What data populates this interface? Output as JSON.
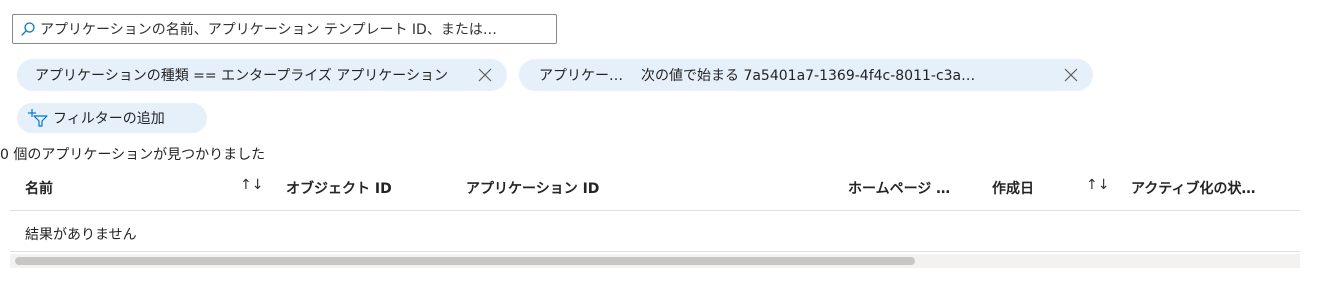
{
  "search": {
    "placeholder": "アプリケーションの名前、アプリケーション テンプレート ID、または…"
  },
  "filters": [
    {
      "label": "アプリケーションの種類 == エンタープライズ アプリケーション"
    },
    {
      "field": "アプリケー…",
      "label": "次の値で始まる 7a5401a7-1369-4f4c-8011-c3a…"
    }
  ],
  "add_filter": {
    "label": "フィルターの追加"
  },
  "result_count": "0 個のアプリケーションが見つかりました",
  "table": {
    "columns": [
      {
        "label": "名前",
        "sortable": true
      },
      {
        "label": "オブジェクト ID",
        "sortable": false
      },
      {
        "label": "アプリケーション ID",
        "sortable": false
      },
      {
        "label": "ホームページ …",
        "sortable": false
      },
      {
        "label": "作成日",
        "sortable": true
      },
      {
        "label": "アクティブ化の状…",
        "sortable": false
      }
    ],
    "sort_glyph": "↑↓",
    "empty_message": "結果がありません"
  },
  "icons": {
    "search": "search-icon",
    "close": "close-icon",
    "add_filter": "add-filter-icon"
  },
  "colors": {
    "pill_bg": "#e6f0fa",
    "accent": "#0078d4"
  }
}
